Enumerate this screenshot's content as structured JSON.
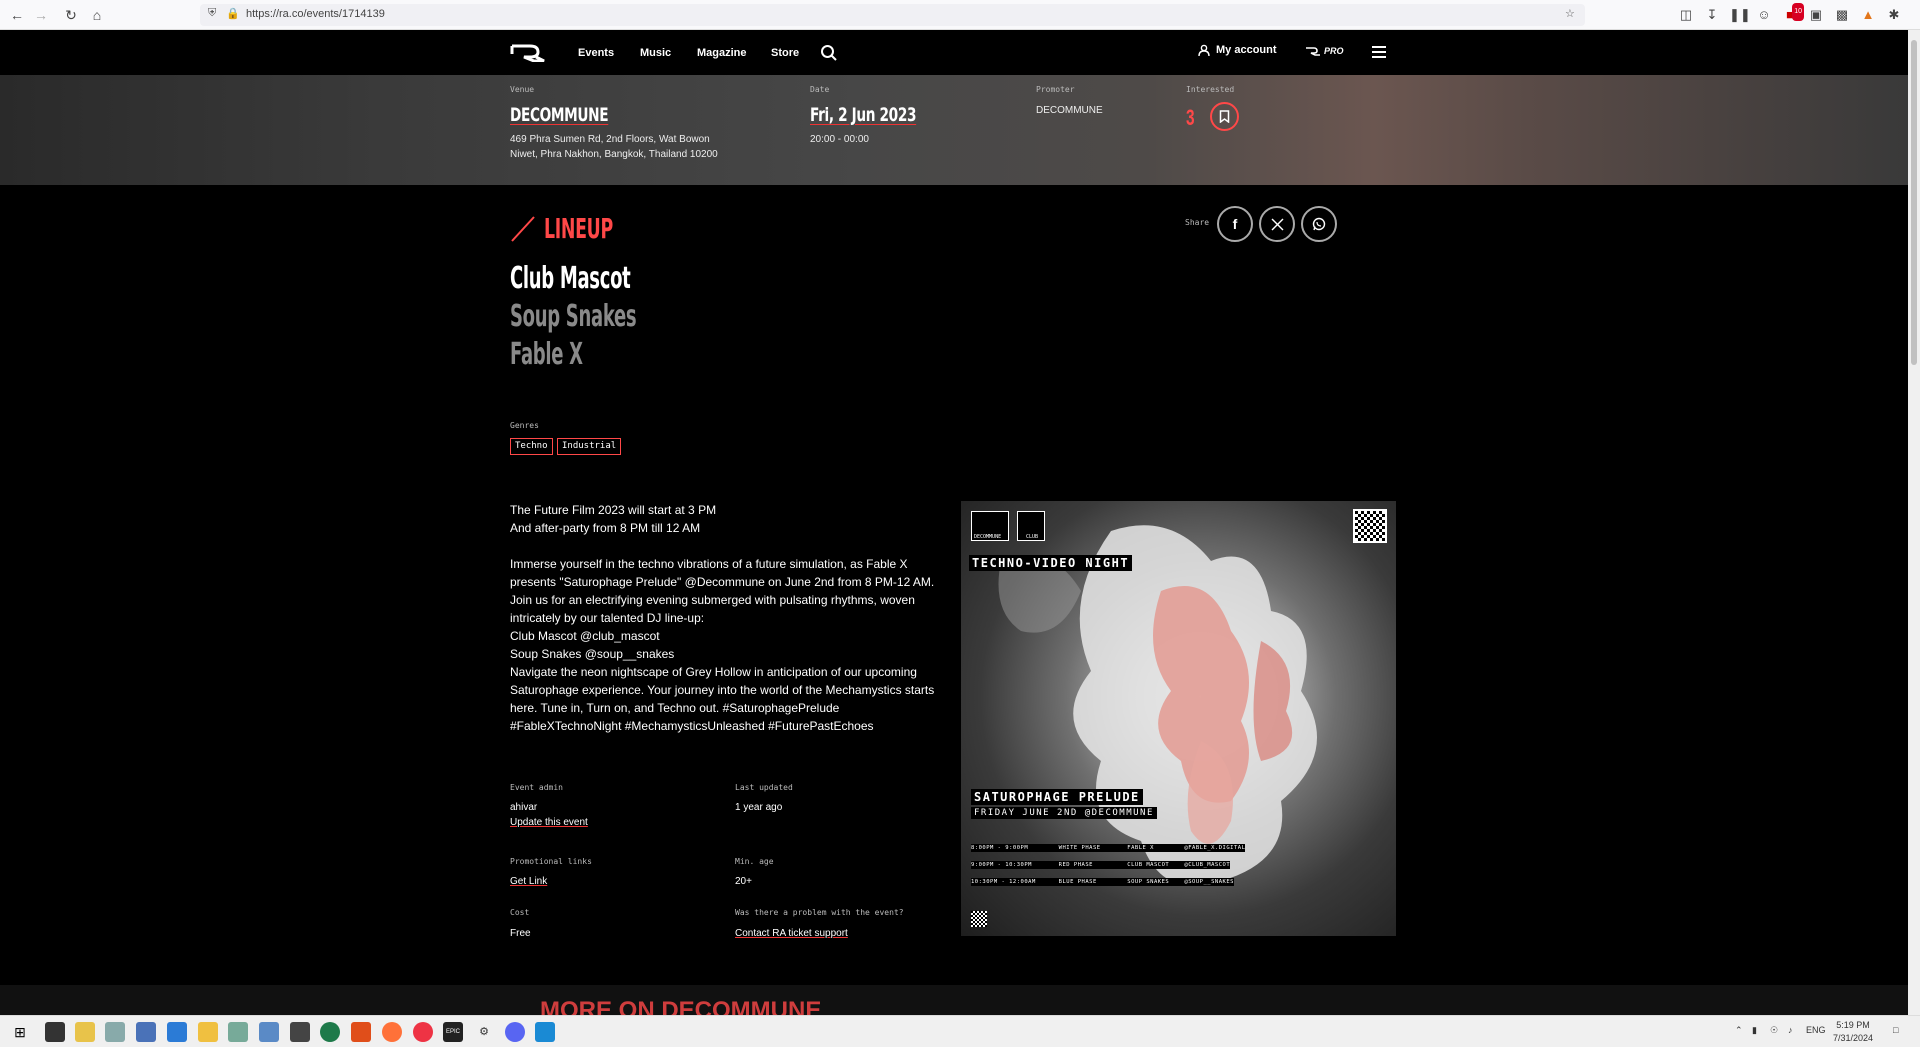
{
  "browser": {
    "url": "https://ra.co/events/1714139",
    "badge": "10"
  },
  "header": {
    "nav": [
      "Events",
      "Music",
      "Magazine",
      "Store"
    ],
    "account": "My account",
    "pro": "PRO"
  },
  "event": {
    "venue_label": "Venue",
    "venue": "DECOMMUNE",
    "address_line1": "469 Phra Sumen Rd, 2nd Floors, Wat Bowon",
    "address_line2": "Niwet, Phra Nakhon, Bangkok, Thailand 10200",
    "date_label": "Date",
    "date": "Fri, 2 Jun 2023",
    "time": "20:00 - 00:00",
    "promoter_label": "Promoter",
    "promoter": "DECOMMUNE",
    "interested_label": "Interested",
    "interested": "3"
  },
  "lineup": {
    "title": "LINEUP",
    "artists": [
      "Club Mascot",
      "Soup Snakes",
      "Fable X"
    ]
  },
  "share": {
    "label": "Share"
  },
  "genres": {
    "label": "Genres",
    "items": [
      "Techno",
      "Industrial"
    ]
  },
  "description": {
    "p1": [
      "The Future Film 2023 will start at 3 PM",
      "And after-party from 8 PM till 12 AM"
    ],
    "p2": [
      "Immerse yourself in the techno vibrations of a future simulation, as Fable X",
      "presents \"Saturophage Prelude\" @Decommune on June 2nd from 8 PM-12 AM.",
      "Join us for an electrifying evening submerged with pulsating rhythms, woven",
      "intricately by our talented DJ line-up:",
      "Club Mascot @club_mascot",
      "Soup Snakes @soup__snakes",
      "Navigate the neon nightscape of Grey Hollow in anticipation of our upcoming",
      "Saturophage experience. Your journey into the world of the Mechamystics starts",
      "here. Tune in, Turn on, and Techno out. #SaturophagePrelude",
      "#FableXTechnoNight #MechamysticsUnleashed #FuturePastEchoes"
    ]
  },
  "meta": {
    "admin_label": "Event admin",
    "admin": "ahivar",
    "update_link": "Update this event",
    "updated_label": "Last updated",
    "updated": "1 year ago",
    "promo_label": "Promotional links",
    "promo_link": "Get Link",
    "age_label": "Min. age",
    "age": "20+",
    "cost_label": "Cost",
    "cost": "Free",
    "problem_label": "Was there a problem with the event?",
    "problem_link": "Contact RA ticket support"
  },
  "flyer": {
    "logo1": "DECOMMUNE",
    "logo2": "CLUB",
    "headline": "TECHNO-VIDEO NIGHT",
    "title": "SATUROPHAGE PRELUDE",
    "subtitle": "FRIDAY JUNE 2ND @DECOMMUNE",
    "rows": [
      "8:00PM - 9:00PM        WHITE PHASE       FABLE X        @FABLE_X.DIGITAL",
      "9:00PM - 10:30PM       RED PHASE         CLUB MASCOT    @CLUB_MASCOT",
      "10:30PM - 12:00AM      BLUE PHASE        SOUP SNAKES    @SOUP__SNAKES"
    ]
  },
  "peek": {
    "text": "MORE ON DECOMMUNE"
  },
  "taskbar": {
    "lang": "ENG",
    "time": "5:19 PM",
    "date": "7/31/2024"
  },
  "colors": {
    "accent": "#ff4848",
    "background": "#000000"
  }
}
